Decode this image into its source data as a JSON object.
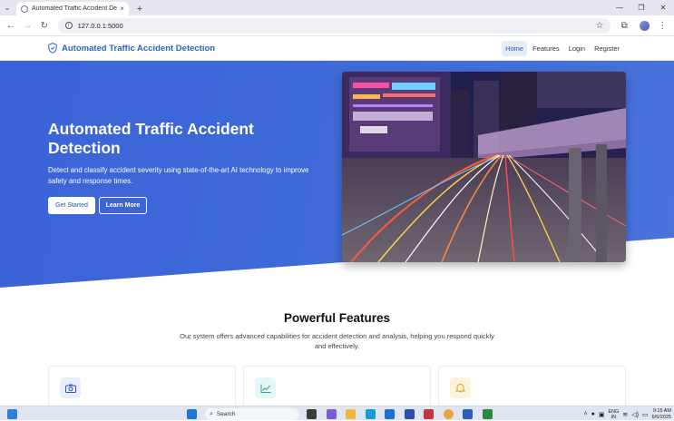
{
  "browser": {
    "tab_title": "Automated Traffic Accident De",
    "tab_close": "×",
    "new_tab": "+",
    "url": "127.0.0.1:5000",
    "window_controls": {
      "minimize": "—",
      "maximize": "❐",
      "close": "✕"
    }
  },
  "site": {
    "brand": "Automated Traffic Accident Detection",
    "nav": [
      "Home",
      "Features",
      "Login",
      "Register"
    ],
    "active_nav": "Home"
  },
  "hero": {
    "title": "Automated Traffic Accident Detection",
    "subtitle": "Detect and classify accident severity using state-of-the-art AI technology to improve safety and response times.",
    "primary_button": "Get Started",
    "secondary_button": "Learn More"
  },
  "features": {
    "title": "Powerful Features",
    "subtitle": "Our system offers advanced capabilities for accident detection and analysis, helping you respond quickly and effectively.",
    "cards": [
      {
        "icon": "camera-icon",
        "color": "#2a56b8",
        "bg": "#e8eefb"
      },
      {
        "icon": "chart-line-icon",
        "color": "#2fa3a0",
        "bg": "#e5f6f5"
      },
      {
        "icon": "bell-icon",
        "color": "#e0a020",
        "bg": "#fdf3dd"
      }
    ]
  },
  "taskbar": {
    "search_placeholder": "Search",
    "lang_line1": "ENG",
    "lang_line2": "IN",
    "time": "9:15 AM",
    "date": "6/6/2025"
  },
  "colors": {
    "accent": "#2563c9",
    "hero_bg": "#3d67d8"
  }
}
